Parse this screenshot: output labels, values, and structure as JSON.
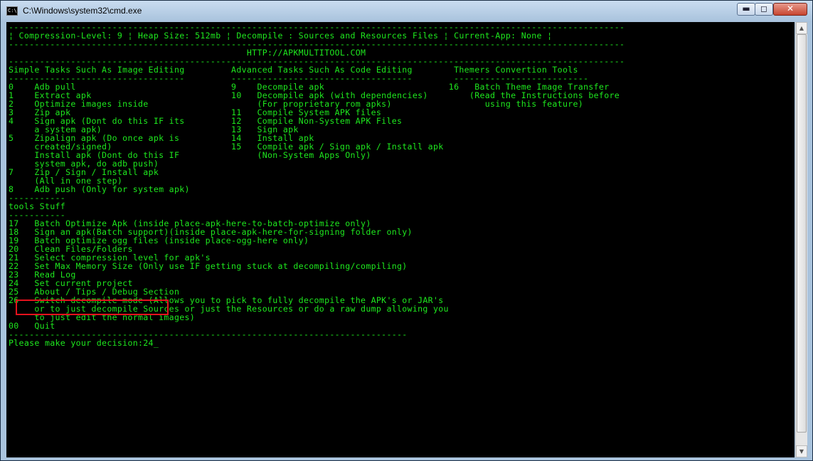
{
  "window": {
    "title": "C:\\Windows\\system32\\cmd.exe",
    "icon_label": "C:\\",
    "buttons": {
      "minimize": "▬",
      "maximize": "◻",
      "close": "✕"
    }
  },
  "console": {
    "lines": [
      "-----------------------------------------------------------------------------------------------------------------------",
      "¦ Compression-Level: 9 ¦ Heap Size: 512mb ¦ Decompile : Sources and Resources Files ¦ Current-App: None ¦",
      "-----------------------------------------------------------------------------------------------------------------------",
      "                                              HTTP://APKMULTITOOL.COM",
      "-----------------------------------------------------------------------------------------------------------------------",
      "Simple Tasks Such As Image Editing         Advanced Tasks Such As Code Editing        Themers Convertion Tools",
      "----------------------------------         -----------------------------------        --------------------------",
      "0    Adb pull                              9    Decompile apk                        16   Batch Theme Image Transfer",
      "1    Extract apk                           10   Decompile apk (with dependencies)        (Read the Instructions before",
      "2    Optimize images inside                     (For proprietary rom apks)                  using this feature)",
      "3    Zip apk                               11   Compile System APK files",
      "4    Sign apk (Dont do this IF its         12   Compile Non-System APK Files",
      "     a system apk)                         13   Sign apk",
      "5    Zipalign apk (Do once apk is          14   Install apk",
      "     created/signed)                       15   Compile apk / Sign apk / Install apk",
      "     Install apk (Dont do this IF               (Non-System Apps Only)",
      "     system apk, do adb push)",
      "7    Zip / Sign / Install apk",
      "     (All in one step)",
      "8    Adb push (Only for system apk)",
      "-----------",
      "tools Stuff",
      "-----------",
      "17   Batch Optimize Apk (inside place-apk-here-to-batch-optimize only)",
      "18   Sign an apk(Batch support)(inside place-apk-here-for-signing folder only)",
      "19   Batch optimize ogg files (inside place-ogg-here only)",
      "20   Clean Files/Folders",
      "21   Select compression level for apk's",
      "22   Set Max Memory Size (Only use IF getting stuck at decompiling/compiling)",
      "23   Read Log",
      "24   Set current project",
      "25   About / Tips / Debug Section",
      "26   Switch decompile mode (Allows you to pick to fully decompile the APK's or JAR's",
      "     or to just decompile Sources or just the Resources or do a raw dump allowing you",
      "     to just edit the normal images)",
      "00   Quit",
      "-----------------------------------------------------------------------------"
    ],
    "prompt": "Please make your decision:24",
    "cursor": "_"
  }
}
